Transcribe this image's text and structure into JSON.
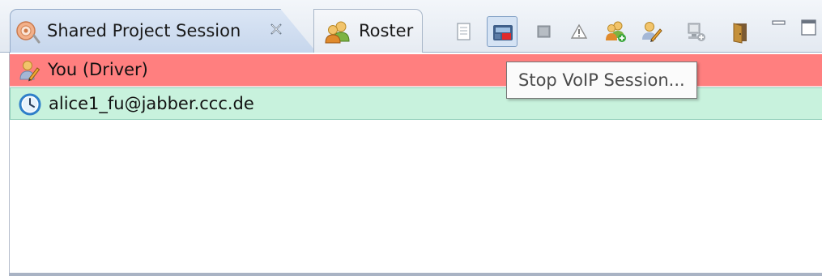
{
  "tabs": {
    "active": {
      "label": "Shared Project Session",
      "icon": "session-icon",
      "close_icon": "close-icon"
    },
    "inactive": {
      "label": "Roster",
      "icon": "roster-icon"
    }
  },
  "toolbar": {
    "items": [
      {
        "name": "document-icon"
      },
      {
        "name": "voip-phone-icon",
        "pressed": true
      },
      {
        "name": "screen-icon"
      },
      {
        "name": "warning-icon"
      },
      {
        "name": "add-buddy-icon"
      },
      {
        "name": "driver-pencil-icon"
      },
      {
        "name": "computer-add-icon"
      },
      {
        "name": "leave-session-door-icon"
      },
      {
        "name": "minimize-icon"
      },
      {
        "name": "maximize-icon"
      }
    ]
  },
  "session_list": {
    "rows": [
      {
        "label": "You (Driver)",
        "icon": "driver-pencil-icon",
        "color": "#ff7f7f"
      },
      {
        "label": "alice1_fu@jabber.ccc.de",
        "icon": "clock-icon",
        "color": "#c8f2dd"
      }
    ]
  },
  "tooltip": {
    "text": "Stop VoIP Session..."
  }
}
